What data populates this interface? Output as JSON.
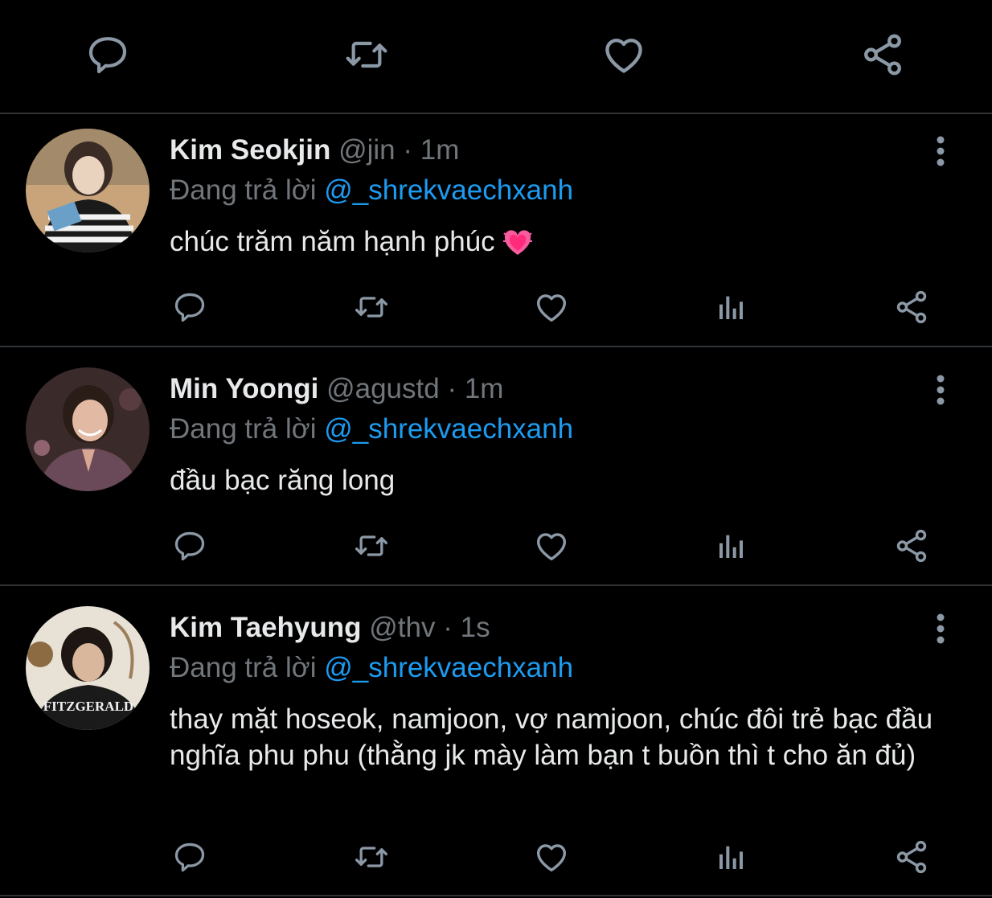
{
  "colors": {
    "background": "#000000",
    "text": "#e7e9ea",
    "muted": "#71767b",
    "link": "#1d9bf0",
    "icon": "#8b98a5",
    "divider": "#2f3336"
  },
  "top_actions": [
    {
      "icon": "reply-icon"
    },
    {
      "icon": "retweet-icon"
    },
    {
      "icon": "like-icon"
    },
    {
      "icon": "share-icon"
    }
  ],
  "tweets": [
    {
      "name": "Kim Seokjin",
      "handle": "@jin",
      "separator": "·",
      "time": "1m",
      "reply_prefix": "Đang trả lời",
      "reply_to": "@_shrekvaechxanh",
      "text": "chúc trăm năm hạnh phúc",
      "emoji": "beating-heart-emoji"
    },
    {
      "name": "Min Yoongi",
      "handle": "@agustd",
      "separator": "·",
      "time": "1m",
      "reply_prefix": "Đang trả lời",
      "reply_to": "@_shrekvaechxanh",
      "text": "đầu bạc răng long"
    },
    {
      "name": "Kim Taehyung",
      "handle": "@thv",
      "separator": "·",
      "time": "1s",
      "reply_prefix": "Đang trả lời",
      "reply_to": "@_shrekvaechxanh",
      "text": "thay mặt hoseok, namjoon, vợ namjoon, chúc đôi trẻ bạc đầu nghĩa phu phu (thằng jk mày làm bạn t buồn thì t cho ăn đủ)",
      "avatar_shirt_text": "FITZGERALD"
    }
  ]
}
